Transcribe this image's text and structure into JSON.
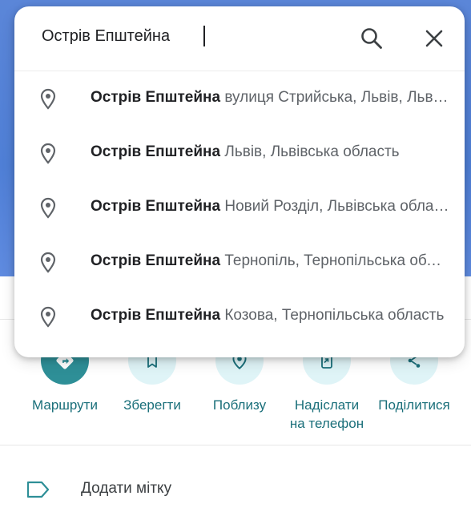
{
  "search": {
    "query": "Острів Епштейна"
  },
  "suggestions": [
    {
      "name": "Острів Епштейна",
      "address": "вулиця Стрийська, Львів, Львівська область"
    },
    {
      "name": "Острів Епштейна",
      "address": "Львів, Львівська область"
    },
    {
      "name": "Острів Епштейна",
      "address": "Новий Розділ, Львівська область"
    },
    {
      "name": "Острів Епштейна",
      "address": "Тернопіль, Тернопільська область"
    },
    {
      "name": "Острів Епштейна",
      "address": "Козова, Тернопільська область"
    }
  ],
  "actions": {
    "directions": "Маршрути",
    "save": "Зберегти",
    "nearby": "Поблизу",
    "send_line1": "Надіслати",
    "send_line2": "на телефон",
    "share": "Поділитися"
  },
  "label_row": {
    "text": "Додати мітку"
  },
  "colors": {
    "accent": "#1a6f7a",
    "primary_button": "#2e8f97",
    "action_circle": "#dff4f7",
    "map": "#4f7fd6"
  },
  "icons": {
    "search": "search-icon",
    "close": "close-icon",
    "pin": "location-pin-icon",
    "directions": "directions-icon",
    "save": "bookmark-icon",
    "nearby": "nearby-icon",
    "send": "send-to-phone-icon",
    "share": "share-icon",
    "label": "label-tag-icon"
  }
}
